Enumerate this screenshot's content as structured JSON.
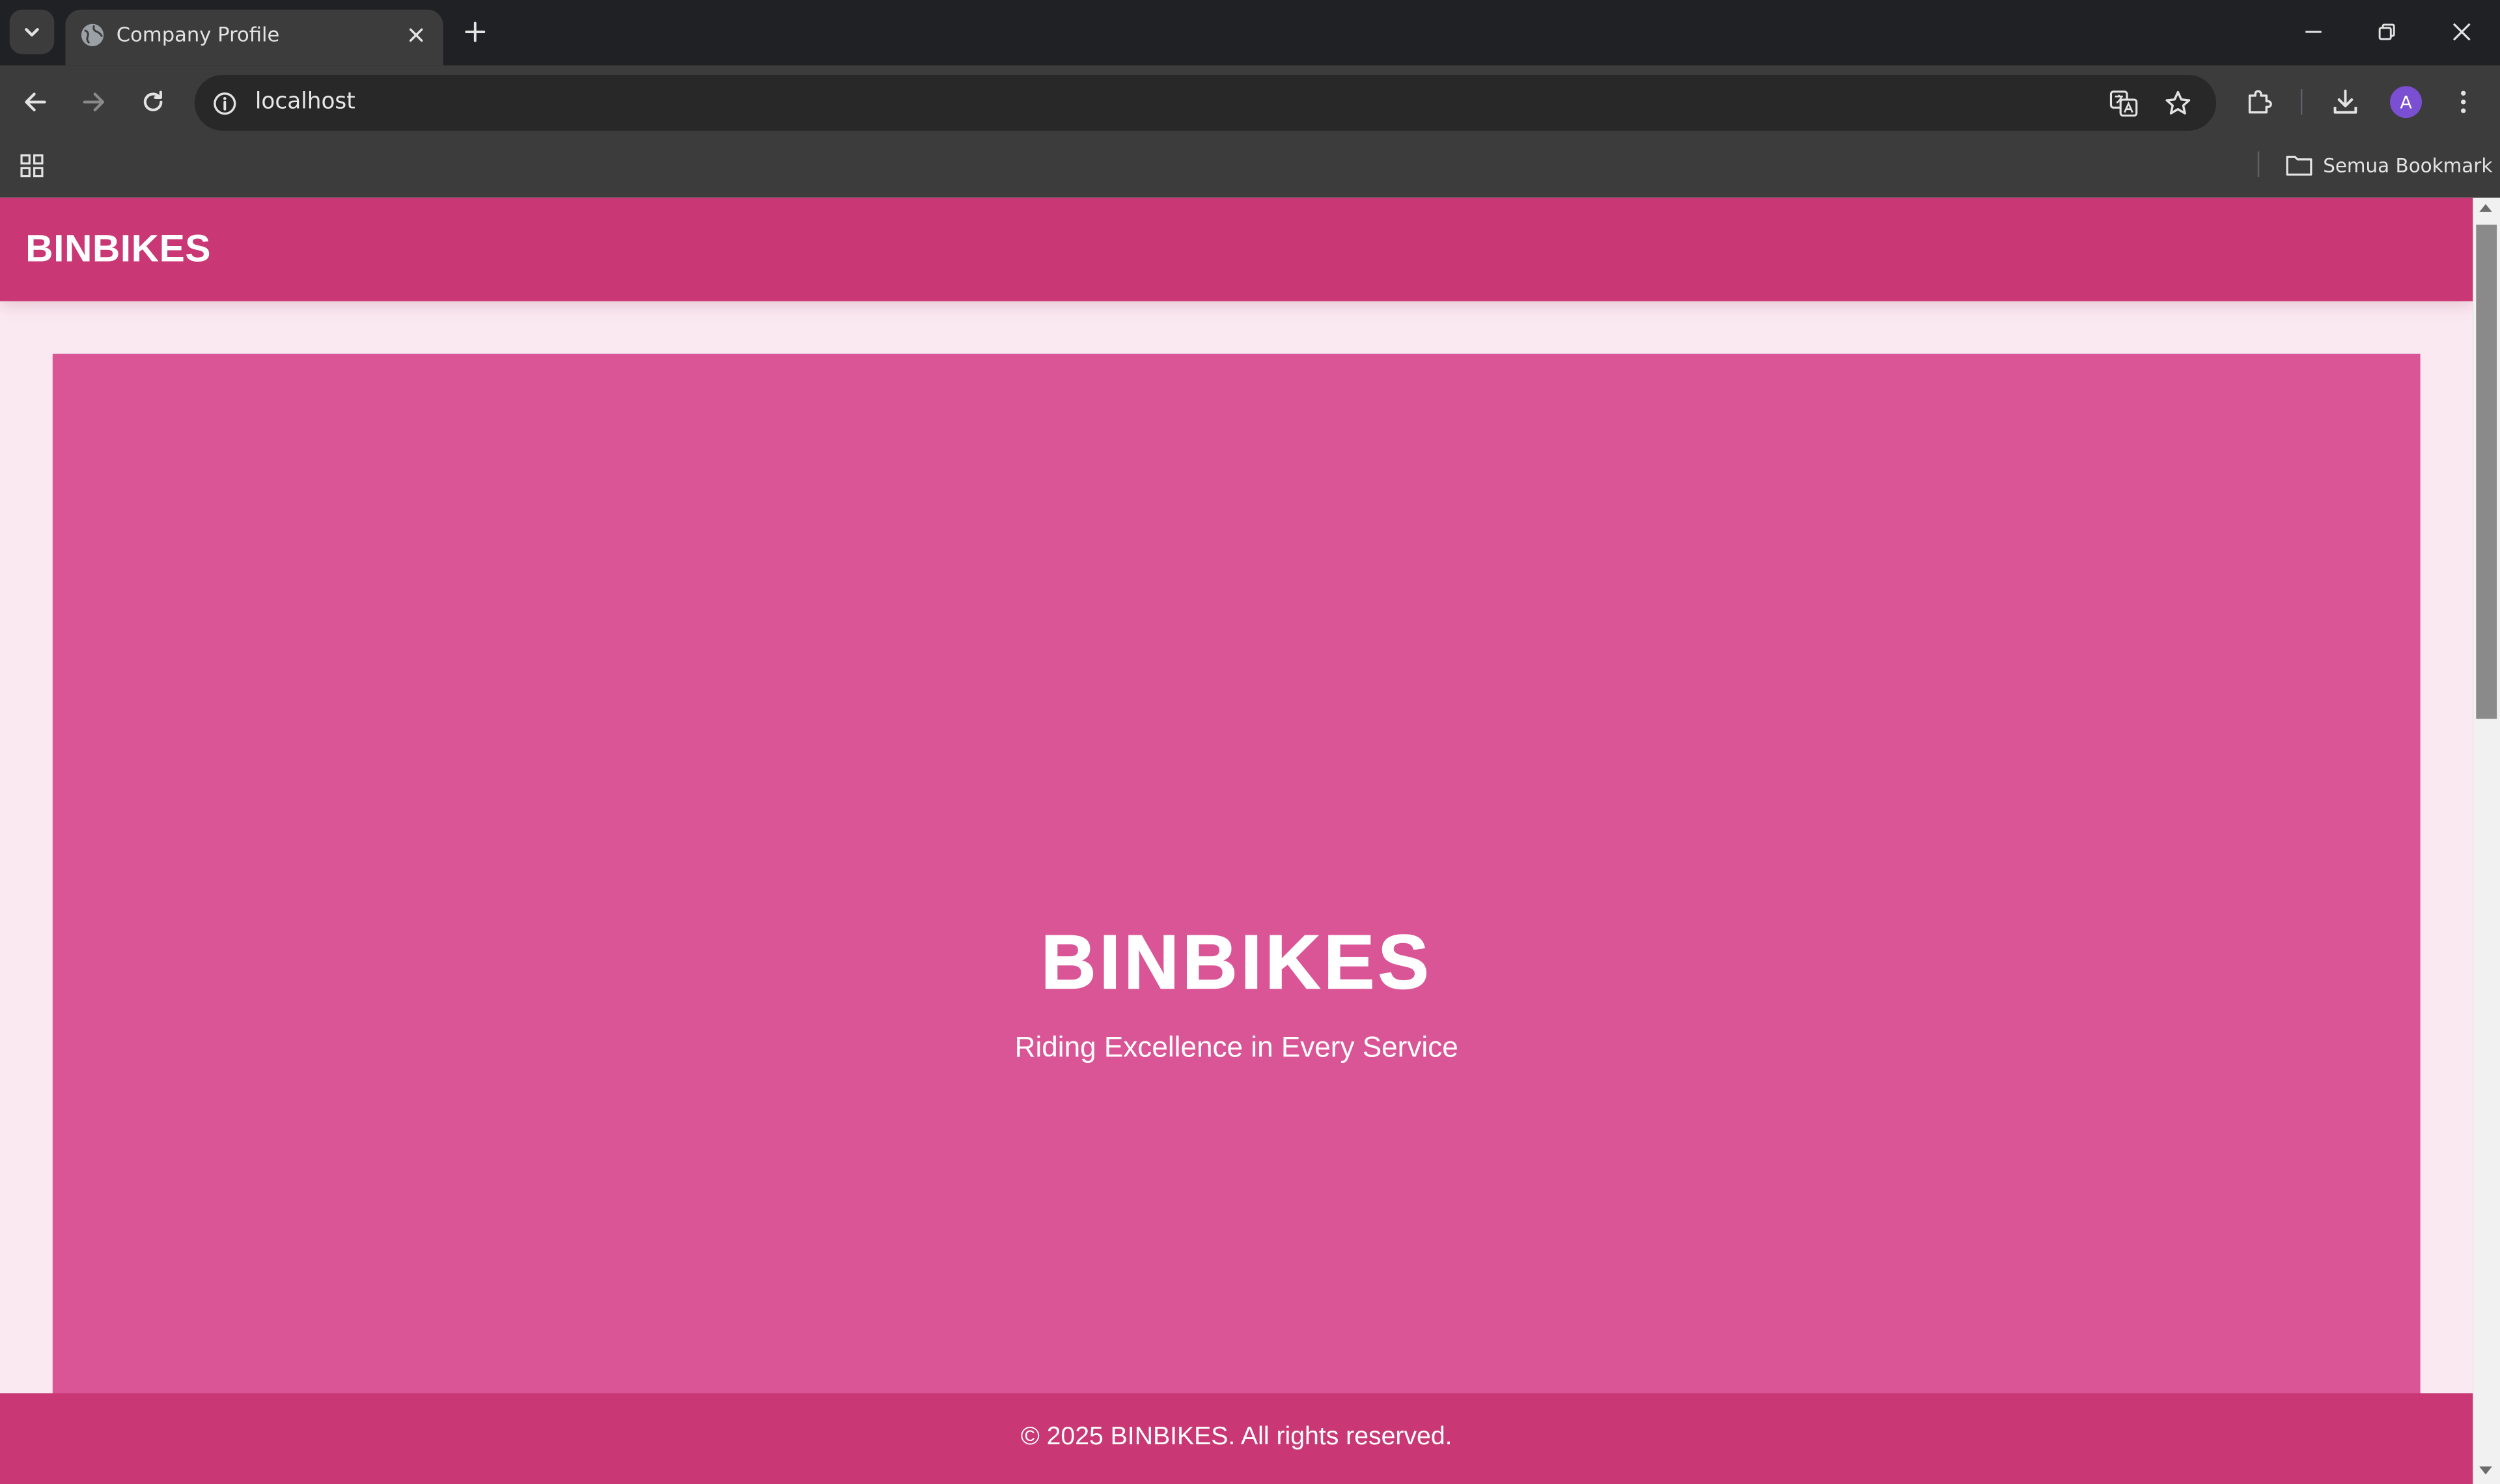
{
  "browser": {
    "tab": {
      "title": "Company Profile"
    },
    "address_bar": {
      "url": "localhost"
    },
    "profile_initial": "A",
    "bookmarks_bar": {
      "all_bookmarks_label": "Semua Bookmark"
    }
  },
  "page": {
    "header": {
      "logo": "BINBIKES"
    },
    "hero": {
      "title": "BINBIKES",
      "subtitle": "Riding Excellence in Every Service"
    },
    "footer": {
      "copyright": "© 2025 BINBIKES. All rights reserved."
    }
  },
  "colors": {
    "brand_primary": "#c93875",
    "hero_background": "#da5596",
    "page_background": "#fbe9f1",
    "browser_frame": "#202124",
    "browser_toolbar": "#3c3c3c"
  },
  "icons": {
    "tab_search": "chevron-down-icon",
    "favicon": "globe-icon",
    "tab_close": "close-icon",
    "new_tab": "plus-icon",
    "minimize": "minimize-icon",
    "restore": "restore-icon",
    "close_window": "close-icon",
    "back": "arrow-left-icon",
    "forward": "arrow-right-icon",
    "reload": "reload-icon",
    "site_info": "info-icon",
    "translate": "translate-icon",
    "bookmark_star": "star-icon",
    "extensions": "puzzle-icon",
    "downloads": "download-icon",
    "menu": "kebab-menu-icon",
    "apps": "apps-grid-icon",
    "folder": "folder-icon"
  }
}
